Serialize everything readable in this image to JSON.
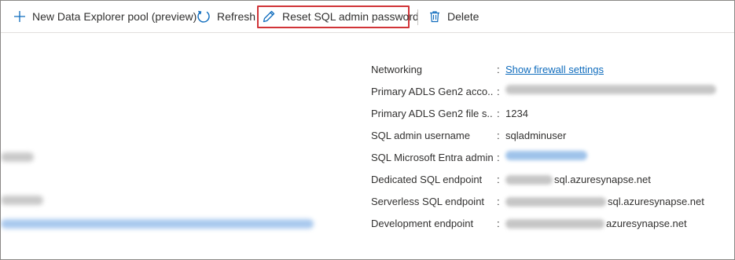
{
  "toolbar": {
    "new_pool_label": "New Data Explorer pool (preview)",
    "refresh_label": "Refresh",
    "reset_label": "Reset SQL admin password",
    "delete_label": "Delete"
  },
  "properties": [
    {
      "label": "Networking",
      "value": "Show firewall settings"
    },
    {
      "label": "Primary ADLS Gen2 acco...",
      "value": ""
    },
    {
      "label": "Primary ADLS Gen2 file s...",
      "value": "1234"
    },
    {
      "label": "SQL admin username",
      "value": "sqladminuser"
    },
    {
      "label": "SQL Microsoft Entra admin",
      "value": ""
    },
    {
      "label": "Dedicated SQL endpoint",
      "value": "sql.azuresynapse.net"
    },
    {
      "label": "Serverless SQL endpoint",
      "value": "sql.azuresynapse.net"
    },
    {
      "label": "Development endpoint",
      "value": "azuresynapse.net"
    }
  ],
  "colors": {
    "accent": "#0f6cbd",
    "highlight_border": "#d13438",
    "text": "#323130"
  },
  "icons": [
    "plus-icon",
    "refresh-icon",
    "pencil-icon",
    "trash-icon"
  ]
}
